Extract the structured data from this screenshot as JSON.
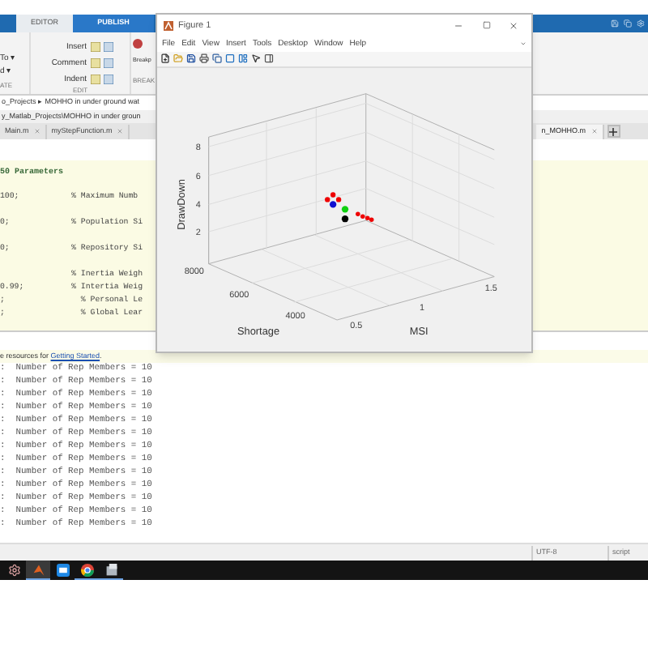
{
  "toolstrip": {
    "tabs": [
      {
        "label": "EDITOR",
        "selected": false
      },
      {
        "label": "PUBLISH",
        "selected": true
      }
    ],
    "navigate": {
      "items": [
        "To ▾",
        "d ▾"
      ],
      "section": "ATE"
    },
    "edit": {
      "items": [
        "Insert",
        "Comment",
        "Indent"
      ],
      "section": "EDIT"
    },
    "breakpoints": {
      "label": "Breakp",
      "section": "BREAK"
    }
  },
  "address_bar": {
    "path": "o_Projects ▸ MOHHO in under ground wat"
  },
  "editor": {
    "file_path": "y_Matlab_Projects\\MOHHO in under groun",
    "tabs": [
      {
        "label": "Main.m",
        "selected": false
      },
      {
        "label": "myStepFunction.m",
        "selected": false
      },
      {
        "label": "n_MOHHO.m",
        "selected": true
      }
    ],
    "code_lines": [
      {
        "kind": "heading",
        "text": "50 Parameters"
      },
      {
        "kind": "blank"
      },
      {
        "kind": "code",
        "text": "100;           % Maximum Numb"
      },
      {
        "kind": "blank"
      },
      {
        "kind": "code",
        "text": "0;             % Population Si"
      },
      {
        "kind": "blank"
      },
      {
        "kind": "code",
        "text": "0;             % Repository Si"
      },
      {
        "kind": "blank"
      },
      {
        "kind": "code",
        "text": "               % Inertia Weigh"
      },
      {
        "kind": "code",
        "text": "0.99;          % Intertia Weig"
      },
      {
        "kind": "code",
        "text": ";                % Personal Le"
      },
      {
        "kind": "code",
        "text": ";                % Global Lear"
      }
    ]
  },
  "command_window": {
    "info": {
      "text": "e resources for ",
      "link": "Getting Started",
      "end": "."
    },
    "lines": [
      ":  Number of Rep Members = 10",
      ":  Number of Rep Members = 10",
      ":  Number of Rep Members = 10",
      ":  Number of Rep Members = 10",
      ":  Number of Rep Members = 10",
      ":  Number of Rep Members = 10",
      ":  Number of Rep Members = 10",
      ":  Number of Rep Members = 10",
      ":  Number of Rep Members = 10",
      ":  Number of Rep Members = 10",
      ":  Number of Rep Members = 10",
      ":  Number of Rep Members = 10",
      ":  Number of Rep Members = 10"
    ]
  },
  "status_bar": [
    "UTF-8",
    "script"
  ],
  "taskbar": [
    {
      "kind": "settings",
      "selected": false,
      "running": false
    },
    {
      "kind": "matlab",
      "selected": true,
      "running": true
    },
    {
      "kind": "mail",
      "selected": false,
      "running": false
    },
    {
      "kind": "browser",
      "selected": false,
      "running": true
    },
    {
      "kind": "app",
      "selected": false,
      "running": true
    }
  ],
  "figure": {
    "title": "Figure 1",
    "menu": [
      "File",
      "Edit",
      "View",
      "Insert",
      "Tools",
      "Desktop",
      "Window",
      "Help"
    ],
    "axes": {
      "zlabel": "DrawDown",
      "xlabel": "Shortage",
      "ylabel": "MSI",
      "zticks": [
        "8",
        "6",
        "4",
        "2"
      ],
      "xticks": [
        "8000",
        "6000",
        "4000"
      ],
      "yticks": [
        "0.5",
        "1",
        "1.5"
      ]
    }
  }
}
